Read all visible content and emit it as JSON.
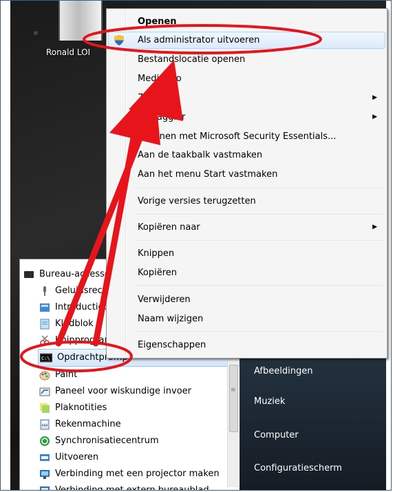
{
  "desktop": {
    "icon_label": "Ronald LOI"
  },
  "context_menu": {
    "items": [
      {
        "label": "Openen",
        "bold": true
      },
      {
        "label": "Als administrator uitvoeren"
      },
      {
        "label": "Bestandslocatie openen"
      },
      {
        "label": "MediaInfo"
      },
      {
        "label": "7-Zip"
      },
      {
        "label": "Defraggler"
      },
      {
        "label": "Scannen met Microsoft Security Essentials..."
      },
      {
        "label": "Aan de taakbalk vastmaken"
      },
      {
        "label": "Aan het menu Start vastmaken"
      },
      {
        "label": "Vorige versies terugzetten"
      },
      {
        "label": "Kopiëren naar"
      },
      {
        "label": "Knippen"
      },
      {
        "label": "Kopiëren"
      },
      {
        "label": "Verwijderen"
      },
      {
        "label": "Naam wijzigen"
      },
      {
        "label": "Eigenschappen"
      }
    ],
    "submenu_arrow": "▶"
  },
  "start_menu": {
    "folder": "Bureau-accessoires",
    "items": [
      "Geluidsrecorder",
      "Introductiecentrum",
      "Kladblok",
      "Knipprogramma",
      "Opdrachtprompt",
      "Paint",
      "Paneel voor wiskundige invoer",
      "Plaknotities",
      "Rekenmachine",
      "Synchronisatiecentrum",
      "Uitvoeren",
      "Verbinding met een projector maken",
      "Verbinding met extern bureaublad"
    ],
    "right_items": [
      "Afbeeldingen",
      "Muziek",
      "Computer",
      "Configuratiescherm"
    ]
  },
  "colors": {
    "annotation_red": "#e8141b",
    "highlight_blue": "#a8d8f8"
  }
}
